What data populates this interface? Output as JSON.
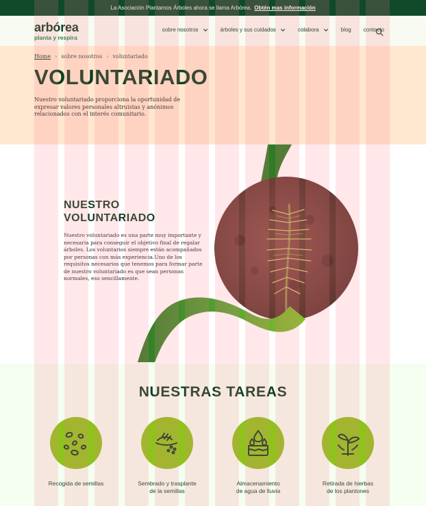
{
  "topbar": {
    "message": "La Asociación Plantamos Árboles ahora se llama Arbórea.",
    "link": "Obtén mas información"
  },
  "header": {
    "logo": {
      "name": "arbórea",
      "tagline": "planta y respira"
    },
    "nav": [
      {
        "label": "sobre nosotros",
        "has_dropdown": true
      },
      {
        "label": "árboles y sus cuidados",
        "has_dropdown": true
      },
      {
        "label": "colabora",
        "has_dropdown": true
      },
      {
        "label": "blog",
        "has_dropdown": false
      },
      {
        "label": "contacto",
        "has_dropdown": false
      }
    ]
  },
  "breadcrumb": {
    "home": "Home",
    "items": [
      "sobre nosotros",
      "voluntariado"
    ]
  },
  "hero": {
    "title": "VOLUNTARIADO",
    "intro": "Nuestro voluntariado proporciona la oportunidad de expresar valores personales altruistas y anónimos relacionados con el interés comunitario."
  },
  "volunteer_section": {
    "title_line1": "NUESTRO",
    "title_line2": "VOLUNTARIADO",
    "body": "Nuestro voluntariado es una parte muy importante y necesaria para conseguir el objetivo final de regalar árboles. Los voluntarios siempre están acompañados por personas con más experiencia.Uno de los requisitos necesarios que tenemos para formar parte de nuestro voluntariado es que sean personas normales, eso sencillamente."
  },
  "tasks": {
    "title": "NUESTRAS TAREAS",
    "items": [
      {
        "icon": "seeds-icon",
        "label_line1": "Recogida de semillas",
        "label_line2": ""
      },
      {
        "icon": "sowing-icon",
        "label_line1": "Sembrado y trasplante",
        "label_line2": "de la semillas"
      },
      {
        "icon": "water-storage-icon",
        "label_line1": "Almacenamiento",
        "label_line2": "de agua de lluvia"
      },
      {
        "icon": "sprout-icon",
        "label_line1": "Retirada de hierbas",
        "label_line2": "de los plantones"
      }
    ]
  },
  "colors": {
    "dark_green": "#0e3d22",
    "topbar_green": "#0f4a2a",
    "accent_lime": "#8fc21d",
    "hero_peach": "#ffe7cf",
    "tasks_bg": "#f5fff1"
  }
}
